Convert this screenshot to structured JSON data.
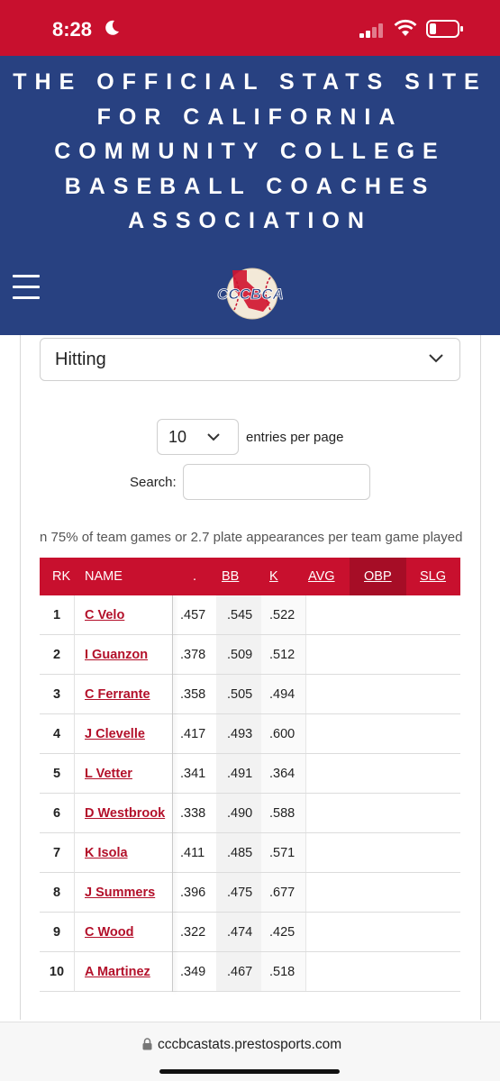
{
  "status_bar": {
    "time": "8:28",
    "icons": [
      "moon-icon",
      "signal-icon",
      "wifi-icon",
      "battery-icon"
    ]
  },
  "header": {
    "title_lines": [
      "THE OFFICIAL STATS SITE",
      "FOR CALIFORNIA",
      "COMMUNITY COLLEGE",
      "BASEBALL COACHES",
      "ASSOCIATION"
    ],
    "logo_text": "CCCBCA",
    "menu_icon": "hamburger-menu-icon"
  },
  "controls": {
    "stat_category": "Hitting",
    "entries_value": "10",
    "entries_label": "entries per page",
    "search_label": "Search:",
    "search_value": ""
  },
  "qualifier_note": "n 75% of team games or 2.7 plate appearances per team game played",
  "table": {
    "headers": {
      "rk": "RK",
      "name": "NAME",
      "partial": ".",
      "bb": "BB",
      "k": "K",
      "avg": "AVG",
      "obp": "OBP",
      "slg": "SLG"
    },
    "rows": [
      {
        "rk": "1",
        "name": "C Velo",
        "a": ".457",
        "bb": ".545",
        "k": ".522"
      },
      {
        "rk": "2",
        "name": "I Guanzon",
        "a": ".378",
        "bb": ".509",
        "k": ".512"
      },
      {
        "rk": "3",
        "name": "C Ferrante",
        "a": ".358",
        "bb": ".505",
        "k": ".494"
      },
      {
        "rk": "4",
        "name": "J Clevelle",
        "a": ".417",
        "bb": ".493",
        "k": ".600"
      },
      {
        "rk": "5",
        "name": "L Vetter",
        "a": ".341",
        "bb": ".491",
        "k": ".364"
      },
      {
        "rk": "6",
        "name": "D Westbrook",
        "a": ".338",
        "bb": ".490",
        "k": ".588"
      },
      {
        "rk": "7",
        "name": "K Isola",
        "a": ".411",
        "bb": ".485",
        "k": ".571"
      },
      {
        "rk": "8",
        "name": "J Summers",
        "a": ".396",
        "bb": ".475",
        "k": ".677"
      },
      {
        "rk": "9",
        "name": "C Wood",
        "a": ".322",
        "bb": ".474",
        "k": ".425"
      },
      {
        "rk": "10",
        "name": "A Martinez",
        "a": ".349",
        "bb": ".467",
        "k": ".518"
      }
    ]
  },
  "browser": {
    "url": "cccbcastats.prestosports.com"
  },
  "colors": {
    "status_bar": "#c8102e",
    "header": "#284181",
    "table_header": "#c8102e",
    "link": "#b3102a"
  }
}
